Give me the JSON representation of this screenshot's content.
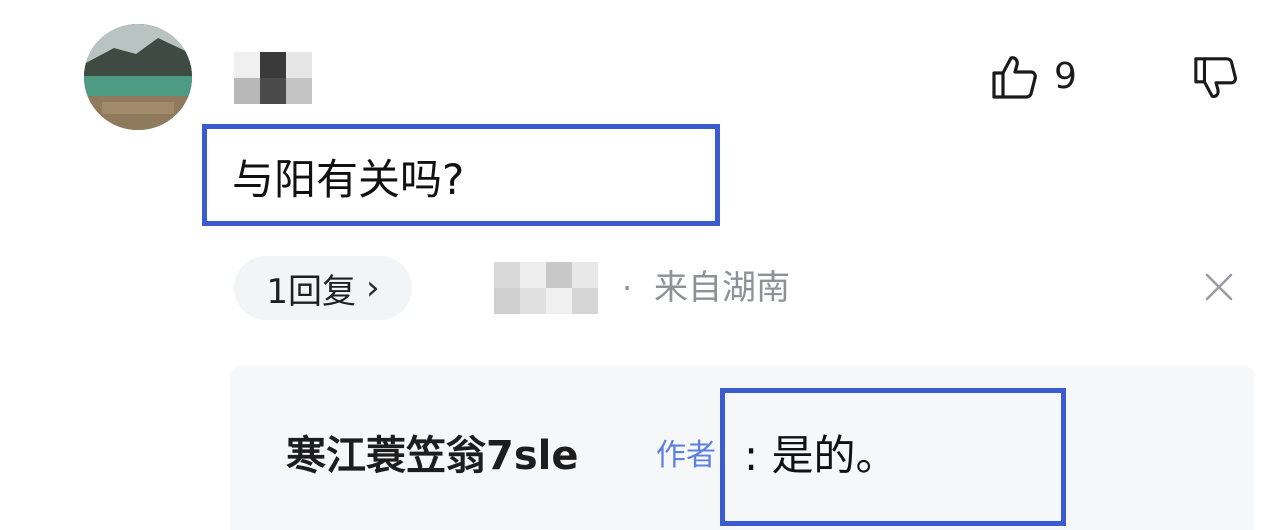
{
  "comment": {
    "text": "与阳有关吗?",
    "like_count": "9"
  },
  "reply_row": {
    "reply_label": "1回复",
    "chevron": "›",
    "separator": "·",
    "location": "来自湖南"
  },
  "reply": {
    "author": "寒江蓑笠翁7sle",
    "author_tag": "作者",
    "text": ": 是的。"
  },
  "icons": {
    "like": "thumbs-up-icon",
    "dislike": "thumbs-down-icon",
    "close": "close-icon"
  },
  "colors": {
    "highlight_border": "#3b5bd0",
    "author_tag": "#5d7fe0",
    "muted_text": "#8e9197",
    "reply_panel_bg": "#f6f7f9"
  }
}
